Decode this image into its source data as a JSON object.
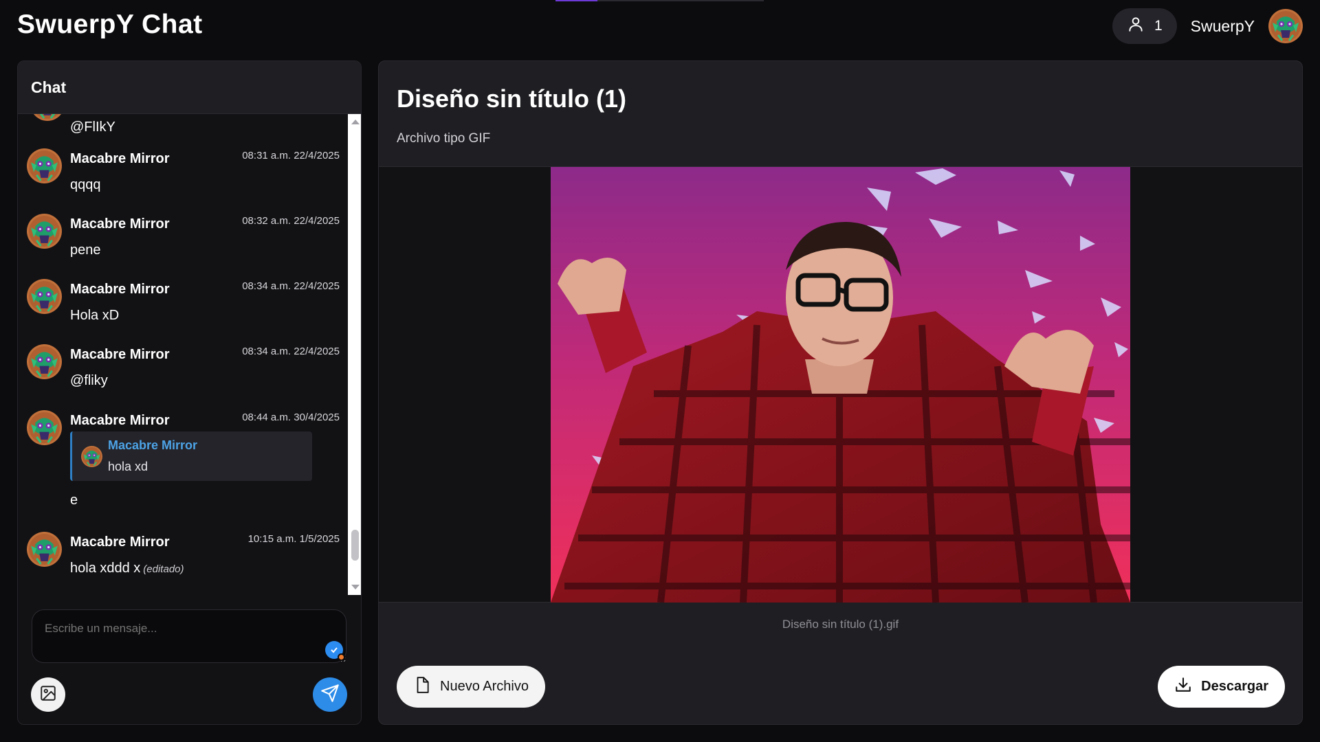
{
  "app": {
    "title": "SwuerpY Chat"
  },
  "header": {
    "online_count": "1",
    "username": "SwuerpY",
    "loading_progress": 0.2
  },
  "colors": {
    "accent_blue": "#2d8ce8",
    "reply_author": "#4da3e6",
    "progress": "#6d3ad8"
  },
  "chat": {
    "title": "Chat",
    "partial_message": "@FlIkY",
    "messages": [
      {
        "author": "Macabre Mirror",
        "time": "08:31 a.m. 22/4/2025",
        "text": "qqqq"
      },
      {
        "author": "Macabre Mirror",
        "time": "08:32 a.m. 22/4/2025",
        "text": "pene"
      },
      {
        "author": "Macabre Mirror",
        "time": "08:34 a.m. 22/4/2025",
        "text": "Hola xD"
      },
      {
        "author": "Macabre Mirror",
        "time": "08:34 a.m. 22/4/2025",
        "text": "@fliky"
      },
      {
        "author": "Macabre Mirror",
        "time": "08:44 a.m. 30/4/2025",
        "reply": {
          "author": "Macabre Mirror",
          "text": "hola xd"
        },
        "text": "e"
      },
      {
        "author": "Macabre Mirror",
        "time": "10:15 a.m. 1/5/2025",
        "text": "hola xddd x",
        "edited_label": "(editado)"
      }
    ],
    "composer_placeholder": "Escribe un mensaje..."
  },
  "icons": {
    "online": "user-icon",
    "attach": "image-icon",
    "send": "send-icon",
    "new_file": "file-icon",
    "download": "download-icon",
    "grammar": "check-badge-icon"
  },
  "file": {
    "title": "Diseño sin título (1)",
    "subtitle": "Archivo tipo GIF",
    "file_name": "Diseño sin título (1).gif",
    "new_button": "Nuevo Archivo",
    "download_button": "Descargar"
  }
}
